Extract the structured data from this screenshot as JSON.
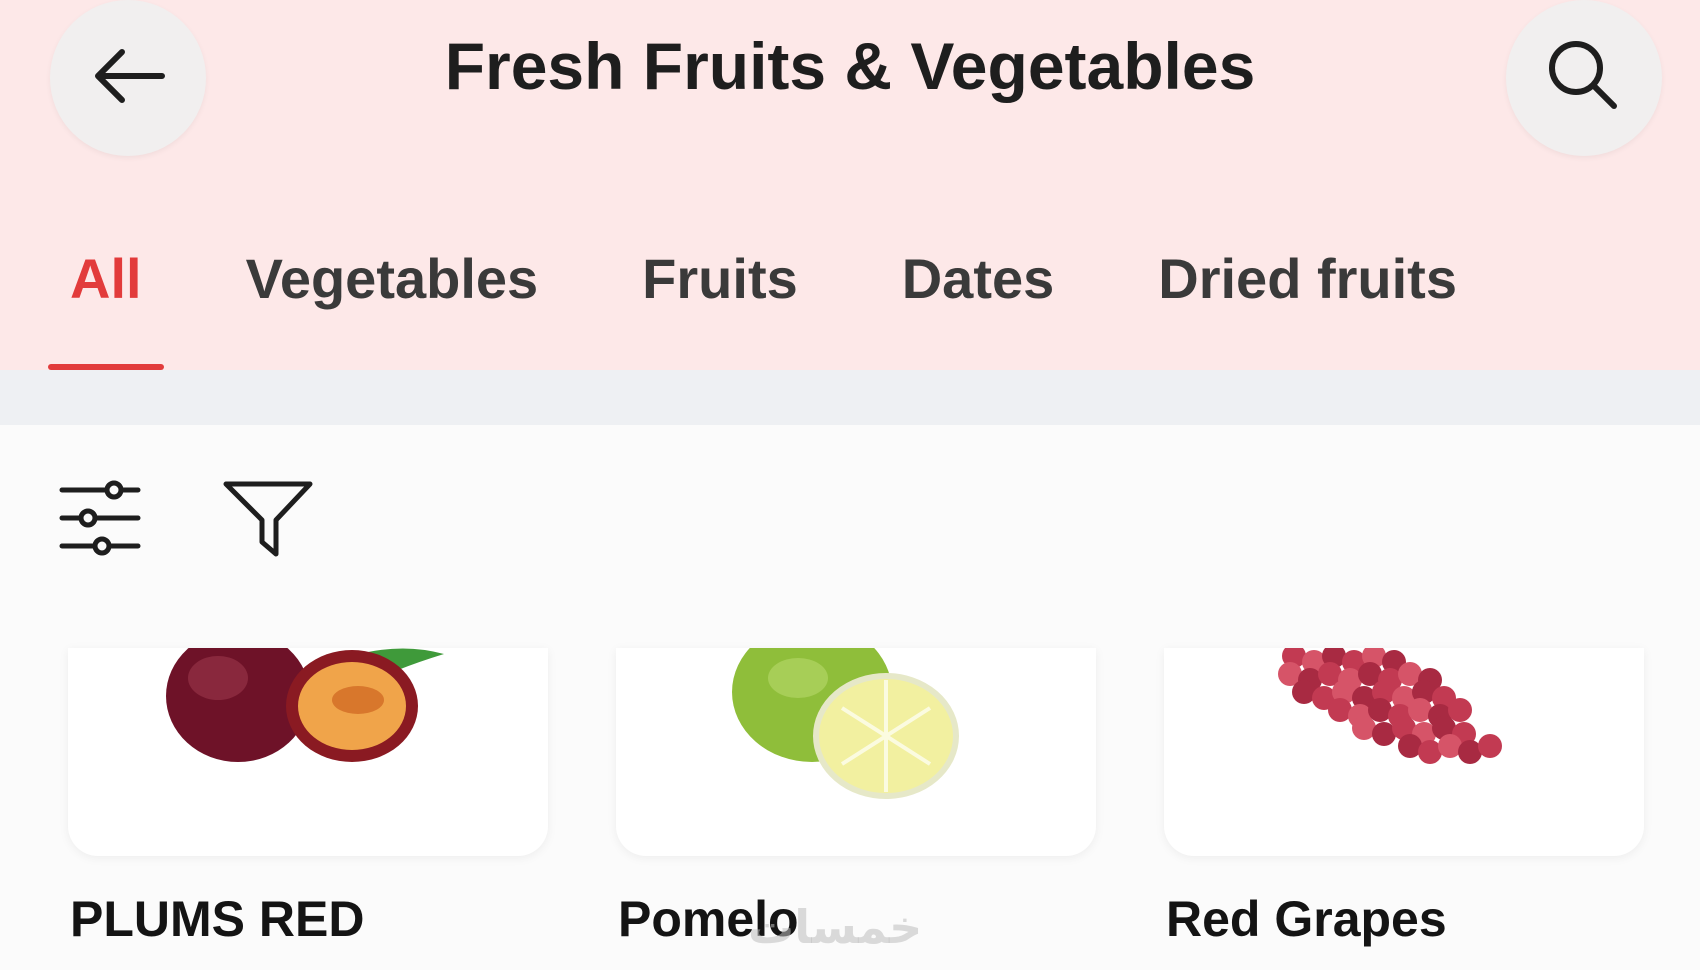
{
  "header": {
    "title": "Fresh Fruits & Vegetables",
    "back_icon": "arrow-left-icon",
    "search_icon": "search-icon"
  },
  "tabs": [
    {
      "label": "All",
      "active": true
    },
    {
      "label": "Vegetables",
      "active": false
    },
    {
      "label": "Fruits",
      "active": false
    },
    {
      "label": "Dates",
      "active": false
    },
    {
      "label": "Dried fruits",
      "active": false
    }
  ],
  "toolbar": {
    "sort_icon": "sliders-icon",
    "filter_icon": "funnel-icon"
  },
  "products": [
    {
      "name": "PLUMS RED"
    },
    {
      "name": "Pomelo"
    },
    {
      "name": "Red Grapes"
    }
  ],
  "watermark": "خمسات",
  "colors": {
    "accent": "#e23b3b",
    "header_bg": "#fde8e8",
    "band": "#eef0f3"
  }
}
